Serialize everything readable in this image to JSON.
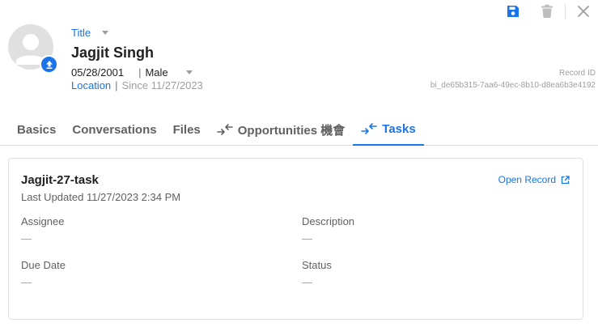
{
  "header": {
    "title_label": "Title",
    "name": "Jagjit Singh",
    "dob": "05/28/2001",
    "separator": "|",
    "gender": "Male",
    "location": "Location",
    "since": "Since 11/27/2023",
    "record_id_label": "Record ID",
    "record_id_value": "bi_de65b315-7aa6-49ec-8b10-d8ea6b3e4192"
  },
  "tabs": [
    {
      "label": "Basics"
    },
    {
      "label": "Conversations"
    },
    {
      "label": "Files"
    },
    {
      "label": "Opportunities 機會"
    },
    {
      "label": "Tasks",
      "active": true
    }
  ],
  "task": {
    "name": "Jagjit-27-task",
    "last_updated": "Last Updated 11/27/2023 2:34 PM",
    "open_record": "Open Record",
    "fields": {
      "assignee": {
        "label": "Assignee",
        "value": "—"
      },
      "description": {
        "label": "Description",
        "value": "—"
      },
      "due_date": {
        "label": "Due Date",
        "value": "—"
      },
      "status": {
        "label": "Status",
        "value": "—"
      }
    }
  },
  "colors": {
    "accent": "#1a73e8",
    "muted": "#9e9e9e",
    "border": "#e0e0e0"
  },
  "icons": {
    "avatar": "person-icon",
    "upload": "upload-icon",
    "save": "save-icon",
    "delete": "trash-icon",
    "close": "close-icon",
    "opportunities": "merge-arrows-icon",
    "tasks": "merge-arrows-icon",
    "open_record": "open-external-icon"
  }
}
